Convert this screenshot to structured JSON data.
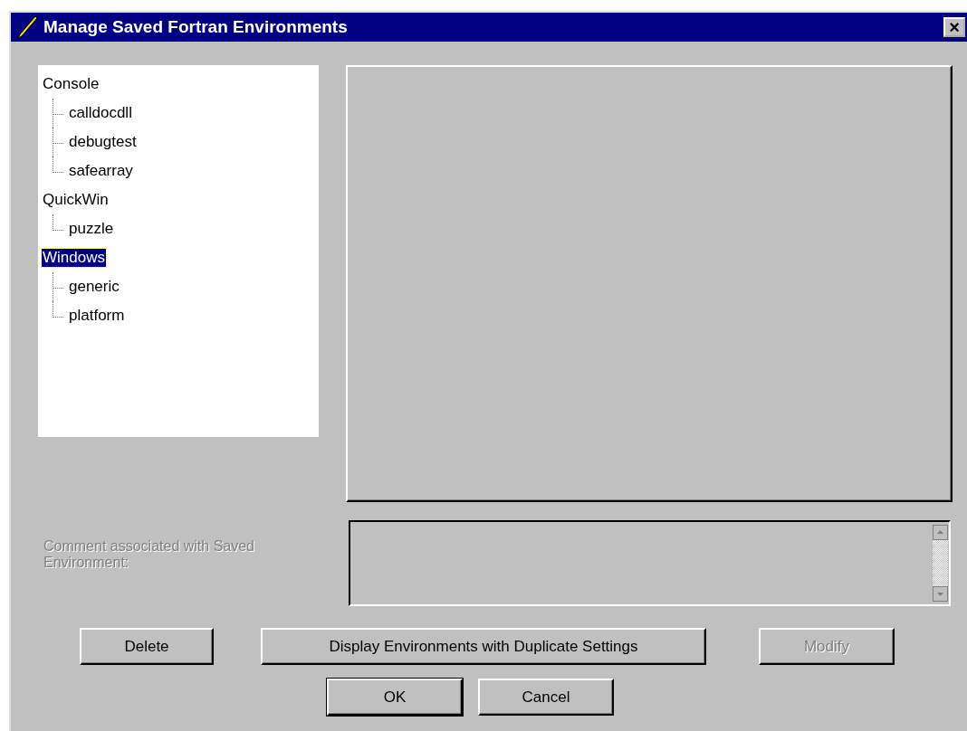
{
  "window": {
    "title": "Manage Saved Fortran Environments",
    "close": "×"
  },
  "tree": [
    {
      "label": "Console",
      "selected": false,
      "children": [
        {
          "label": "calldocdll",
          "selected": false
        },
        {
          "label": "debugtest",
          "selected": false
        },
        {
          "label": "safearray",
          "selected": false
        }
      ]
    },
    {
      "label": "QuickWin",
      "selected": false,
      "children": [
        {
          "label": "puzzle",
          "selected": false
        }
      ]
    },
    {
      "label": "Windows",
      "selected": true,
      "children": [
        {
          "label": "generic",
          "selected": false
        },
        {
          "label": "platform",
          "selected": false
        }
      ]
    }
  ],
  "comment": {
    "label": "Comment associated with Saved Environment:",
    "disabled": true
  },
  "buttons": [
    {
      "label": "Delete",
      "disabled": false,
      "default": false
    },
    {
      "label": "Display Environments with Duplicate Settings",
      "disabled": false,
      "default": false
    },
    {
      "label": "Modify",
      "disabled": true,
      "default": false
    }
  ],
  "dialog_buttons": [
    {
      "label": "OK",
      "disabled": false,
      "default": true
    },
    {
      "label": "Cancel",
      "disabled": false,
      "default": false
    }
  ]
}
